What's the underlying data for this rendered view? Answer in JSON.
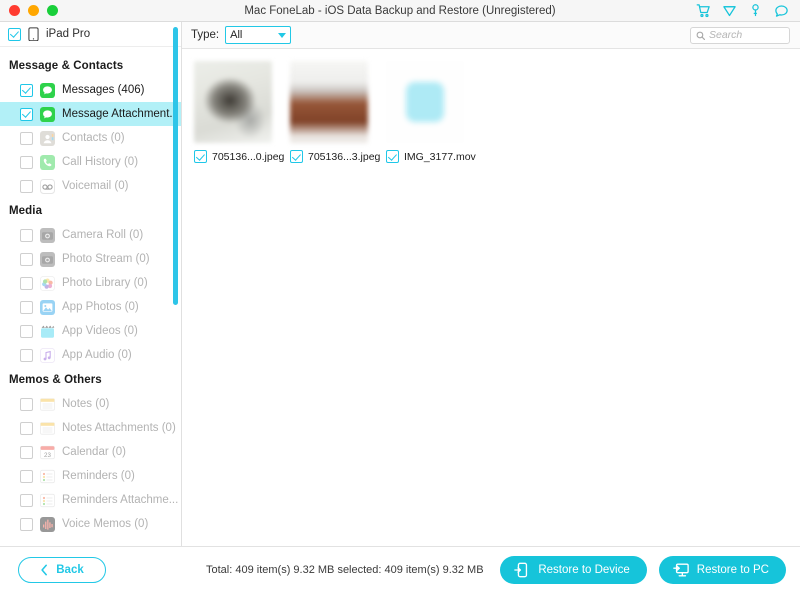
{
  "window": {
    "title": "Mac FoneLab - iOS Data Backup and Restore (Unregistered)",
    "traffic_lights": [
      "close-button",
      "minimize-button",
      "zoom-button"
    ],
    "title_icons": [
      {
        "name": "cart-icon",
        "label": "Cart"
      },
      {
        "name": "gem-icon",
        "label": "Upgrade"
      },
      {
        "name": "key-icon",
        "label": "Register"
      },
      {
        "name": "chat-icon",
        "label": "Support"
      }
    ],
    "accent_color": "#16c4da",
    "select_color": "#b2f0f7"
  },
  "sidebar": {
    "device": {
      "name": "iPad Pro",
      "checked": true,
      "icon": "ipad-icon"
    },
    "groups": [
      {
        "title": "Message & Contacts",
        "items": [
          {
            "label": "Messages (406)",
            "checked": true,
            "enabled": true,
            "icon": "messages-icon"
          },
          {
            "label": "Message Attachment...",
            "checked": true,
            "enabled": true,
            "selected": true,
            "icon": "messages-icon"
          },
          {
            "label": "Contacts (0)",
            "checked": false,
            "enabled": false,
            "icon": "contacts-icon"
          },
          {
            "label": "Call History (0)",
            "checked": false,
            "enabled": false,
            "icon": "phone-icon"
          },
          {
            "label": "Voicemail (0)",
            "checked": false,
            "enabled": false,
            "icon": "voicemail-icon"
          }
        ]
      },
      {
        "title": "Media",
        "items": [
          {
            "label": "Camera Roll (0)",
            "checked": false,
            "enabled": false,
            "icon": "camera-icon"
          },
          {
            "label": "Photo Stream (0)",
            "checked": false,
            "enabled": false,
            "icon": "camera-icon"
          },
          {
            "label": "Photo Library (0)",
            "checked": false,
            "enabled": false,
            "icon": "photos-icon"
          },
          {
            "label": "App Photos (0)",
            "checked": false,
            "enabled": false,
            "icon": "app-photos-icon"
          },
          {
            "label": "App Videos (0)",
            "checked": false,
            "enabled": false,
            "icon": "app-videos-icon"
          },
          {
            "label": "App Audio (0)",
            "checked": false,
            "enabled": false,
            "icon": "app-audio-icon"
          }
        ]
      },
      {
        "title": "Memos & Others",
        "items": [
          {
            "label": "Notes (0)",
            "checked": false,
            "enabled": false,
            "icon": "notes-icon"
          },
          {
            "label": "Notes Attachments (0)",
            "checked": false,
            "enabled": false,
            "icon": "notes-icon"
          },
          {
            "label": "Calendar (0)",
            "checked": false,
            "enabled": false,
            "icon": "calendar-icon"
          },
          {
            "label": "Reminders (0)",
            "checked": false,
            "enabled": false,
            "icon": "reminders-icon"
          },
          {
            "label": "Reminders Attachme...",
            "checked": false,
            "enabled": false,
            "icon": "reminders-icon"
          },
          {
            "label": "Voice Memos (0)",
            "checked": false,
            "enabled": false,
            "icon": "voice-memos-icon"
          }
        ]
      }
    ]
  },
  "toolbar": {
    "type_label": "Type:",
    "type_value": "All",
    "search_placeholder": "Search"
  },
  "content": {
    "files": [
      {
        "name": "705136...0.jpeg",
        "checked": true,
        "thumb": "t1"
      },
      {
        "name": "705136...3.jpeg",
        "checked": true,
        "thumb": "t2"
      },
      {
        "name": "IMG_3177.mov",
        "checked": true,
        "thumb": "t3"
      }
    ]
  },
  "footer": {
    "back_label": "Back",
    "status": "Total: 409 item(s) 9.32 MB   selected: 409 item(s) 9.32 MB",
    "restore_device_label": "Restore to Device",
    "restore_pc_label": "Restore to PC"
  }
}
